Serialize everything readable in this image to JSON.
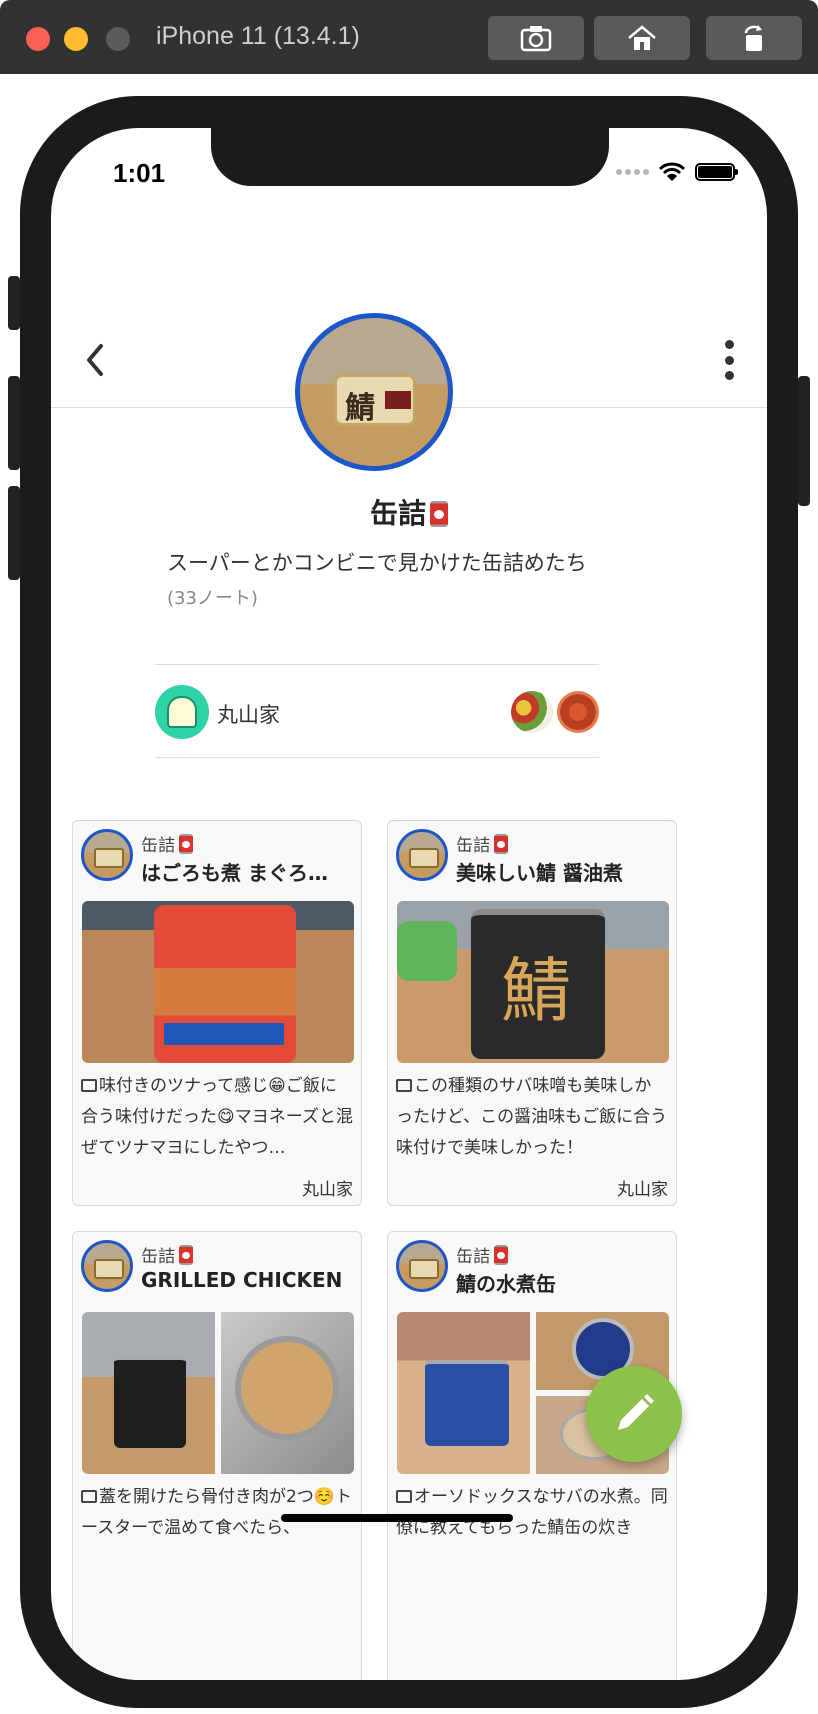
{
  "simulator": {
    "title": "iPhone 11 (13.4.1)"
  },
  "status_bar": {
    "time": "1:01"
  },
  "navbar": {
    "title": "缶詰"
  },
  "board": {
    "title": "缶詰",
    "description": "スーパーとかコンビニで見かけた缶詰めたち",
    "note_count": "(33ノート)",
    "owner_name": "丸山家"
  },
  "cards": [
    {
      "board": "缶詰",
      "title": "はごろも煮 まぐろ…",
      "comment": "味付きのツナって感じ😁ご飯に合う味付けだった😋マヨネーズと混ぜてツナマヨにしたやつ…",
      "author": "丸山家"
    },
    {
      "board": "缶詰",
      "title": "美味しい鯖 醤油煮",
      "comment": "この種類のサバ味噌も美味しかったけど、この醤油味もご飯に合う味付けで美味しかった！",
      "author": "丸山家"
    },
    {
      "board": "缶詰",
      "title": "GRILLED CHICKEN",
      "comment": "蓋を開けたら骨付き肉が2つ☺️トースターで温めて食べたら、"
    },
    {
      "board": "缶詰",
      "title": "鯖の水煮缶",
      "comment": "オーソドックスなサバの水煮。同僚に教えてもらった鯖缶の炊き"
    }
  ],
  "colors": {
    "avatar_border": "#1d56c9",
    "fab": "#8bc34a",
    "owner_avatar": "#2ed3a5"
  },
  "icons": [
    "back-icon",
    "more-icon",
    "comment-icon",
    "pencil-icon",
    "camera-icon",
    "home-icon",
    "rotate-icon"
  ]
}
